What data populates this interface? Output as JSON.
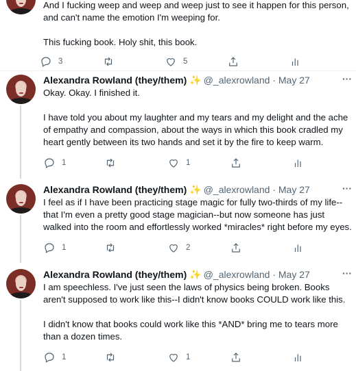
{
  "tweets": [
    {
      "paragraphs": [
        "And I fucking weep and weep and weep just to see it happen for this person, and can't name the emotion I'm weeping for.",
        "This fucking book. Holy shit, this book."
      ],
      "replies": "3",
      "retweets": "",
      "likes": "5"
    },
    {
      "name": "Alexandra Rowland (they/them)",
      "sparkle": "✨",
      "handle": "@_alexrowland",
      "dot": "·",
      "date": "May 27",
      "paragraphs": [
        "Okay. Okay. I finished it.",
        "I have told you about my laughter and my tears and my delight and the ache of empathy and compassion, about the ways in which this book cradled my heart gently between its two hands and set it by the fire to keep warm."
      ],
      "replies": "1",
      "retweets": "",
      "likes": "1"
    },
    {
      "name": "Alexandra Rowland (they/them)",
      "sparkle": "✨",
      "handle": "@_alexrowland",
      "dot": "·",
      "date": "May 27",
      "paragraphs": [
        "I feel as if I have been practicing stage magic for fully two-thirds of my life--that I'm even a pretty good stage magician--but now someone has just walked into the room and effortlessly worked *miracles* right before my eyes."
      ],
      "replies": "1",
      "retweets": "",
      "likes": "2"
    },
    {
      "name": "Alexandra Rowland (they/them)",
      "sparkle": "✨",
      "handle": "@_alexrowland",
      "dot": "·",
      "date": "May 27",
      "paragraphs": [
        "I am speechless. I've just seen the laws of physics being broken. Books aren't supposed to work like this--I didn't know books COULD work like this.",
        "I didn't know that books could work like this *AND* bring me to tears more than a dozen times."
      ],
      "replies": "1",
      "retweets": "",
      "likes": "1"
    }
  ],
  "more_label": "···",
  "icons": [
    "reply-icon",
    "retweet-icon",
    "like-icon",
    "share-icon",
    "analytics-icon",
    "more-icon"
  ]
}
